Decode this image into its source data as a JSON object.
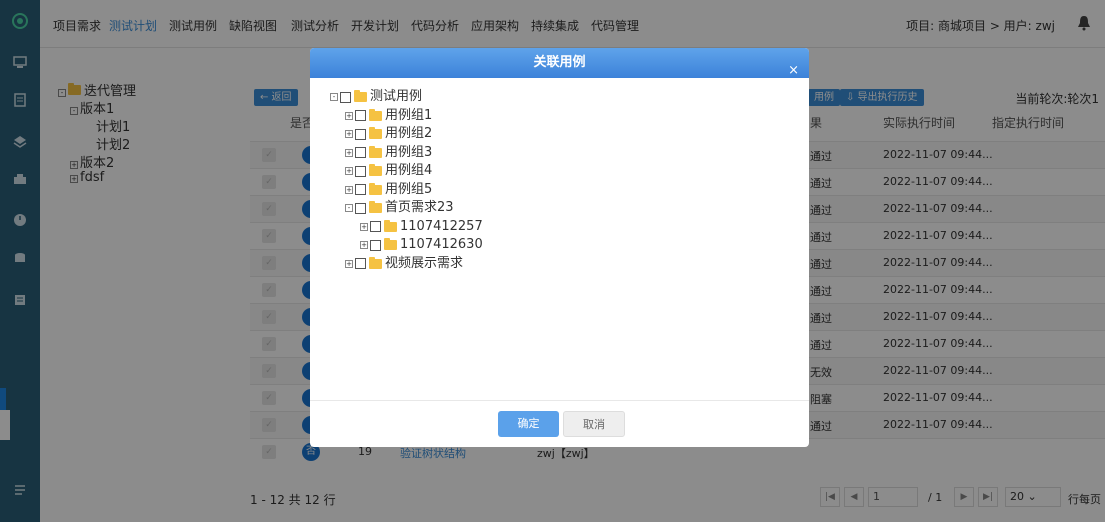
{
  "sidebar": {
    "icons": [
      "logo-icon",
      "monitor-icon",
      "clipboard-icon",
      "layers-icon",
      "printer-icon",
      "clock-icon",
      "database-icon",
      "list-icon",
      "menu-icon"
    ]
  },
  "topnav": {
    "items": [
      "项目需求",
      "测试计划",
      "测试用例",
      "缺陷视图",
      "测试分析",
      "开发计划",
      "代码分析",
      "应用架构",
      "持续集成",
      "代码管理"
    ],
    "active_index": 1,
    "project_user": "项目: 商城项目 > 用户: zwj"
  },
  "left_tree": {
    "root": "迭代管理",
    "version1": "版本1",
    "plan1": "计划1",
    "plan2": "计划2",
    "version2": "版本2",
    "other": "fdsf"
  },
  "toolbar": {
    "back": "← 返回",
    "use_case": "用例",
    "export_history": "⇩ 导出执行历史",
    "current_round": "当前轮次:轮次1"
  },
  "table": {
    "header_col1": "是否",
    "header_result": "果",
    "header_actual_time": "实际执行时间",
    "header_assigned_time": "指定执行时间",
    "rows": [
      {
        "status": "通过",
        "time": "2022-11-07 09:44..."
      },
      {
        "status": "通过",
        "time": "2022-11-07 09:44..."
      },
      {
        "status": "通过",
        "time": "2022-11-07 09:44..."
      },
      {
        "status": "通过",
        "time": "2022-11-07 09:44..."
      },
      {
        "status": "通过",
        "time": "2022-11-07 09:44..."
      },
      {
        "status": "通过",
        "time": "2022-11-07 09:44..."
      },
      {
        "status": "通过",
        "time": "2022-11-07 09:44..."
      },
      {
        "status": "通过",
        "time": "2022-11-07 09:44..."
      },
      {
        "status": "无效",
        "time": "2022-11-07 09:44..."
      },
      {
        "status": "阻塞",
        "time": "2022-11-07 09:44..."
      },
      {
        "status": "通过",
        "time": "2022-11-07 09:44..."
      }
    ],
    "last_row": {
      "avatar": "否",
      "num": "19",
      "name": "验证树状结构",
      "user": "zwj【zwj】"
    }
  },
  "footer": {
    "summary": "1 - 12 共 12 行",
    "page": "1",
    "total_pages": "/ 1",
    "page_size": "20",
    "per_page": "行每页"
  },
  "modal": {
    "title": "关联用例",
    "close": "×",
    "tree": [
      {
        "label": "测试用例",
        "level": 0
      },
      {
        "label": "用例组1",
        "level": 1
      },
      {
        "label": "用例组2",
        "level": 1
      },
      {
        "label": "用例组3",
        "level": 1
      },
      {
        "label": "用例组4",
        "level": 1
      },
      {
        "label": "用例组5",
        "level": 1
      },
      {
        "label": "首页需求23",
        "level": 1
      },
      {
        "label": "1107412257",
        "level": 2
      },
      {
        "label": "1107412630",
        "level": 2
      },
      {
        "label": "视频展示需求",
        "level": 1
      }
    ],
    "ok": "确定",
    "cancel": "取消"
  }
}
